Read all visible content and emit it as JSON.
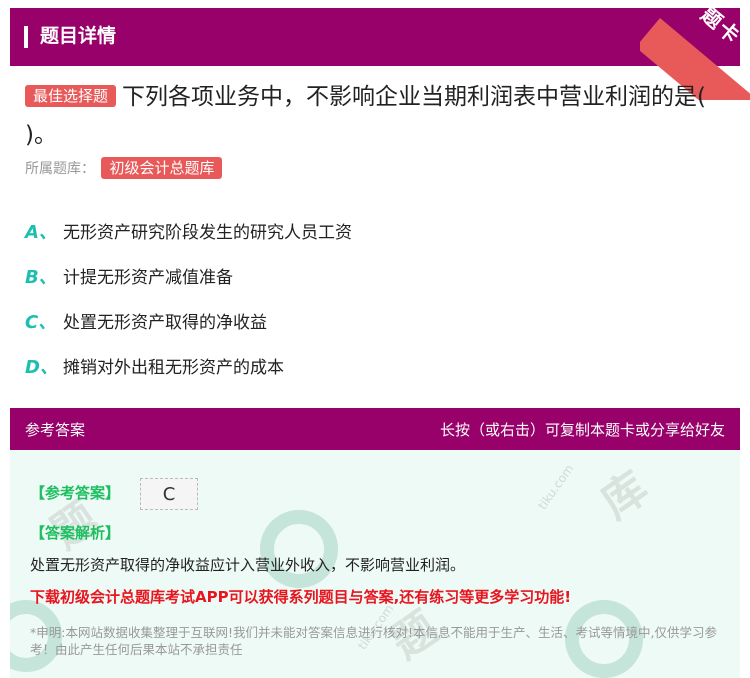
{
  "header": {
    "title": "题目详情",
    "ribbon": "题卡"
  },
  "question": {
    "tag": "最佳选择题",
    "text": "下列各项业务中，不影响企业当期利润表中营业利润的是( )。"
  },
  "bank": {
    "label": "所属题库：",
    "name": "初级会计总题库"
  },
  "options": [
    {
      "letter": "A、",
      "text": "无形资产研究阶段发生的研究人员工资"
    },
    {
      "letter": "B、",
      "text": "计提无形资产减值准备"
    },
    {
      "letter": "C、",
      "text": "处置无形资产取得的净收益"
    },
    {
      "letter": "D、",
      "text": "摊销对外出租无形资产的成本"
    }
  ],
  "answer_header": {
    "left": "参考答案",
    "right": "长按（或右击）可复制本题卡或分享给好友"
  },
  "answer": {
    "ref_label": "【参考答案】",
    "ref_value": "C",
    "analysis_label": "【答案解析】",
    "analysis": "处置无形资产取得的净收益应计入营业外收入，不影响营业利润。",
    "promo": "下载初级会计总题库考试APP可以获得系列题目与答案,还有练习等更多学习功能!",
    "disclaimer": "*申明:本网站数据收集整理于互联网!我们并未能对答案信息进行核对!本信息不能用于生产、生活、考试等情境中,仅供学习参考！由此产生任何后果本站不承担责任"
  }
}
